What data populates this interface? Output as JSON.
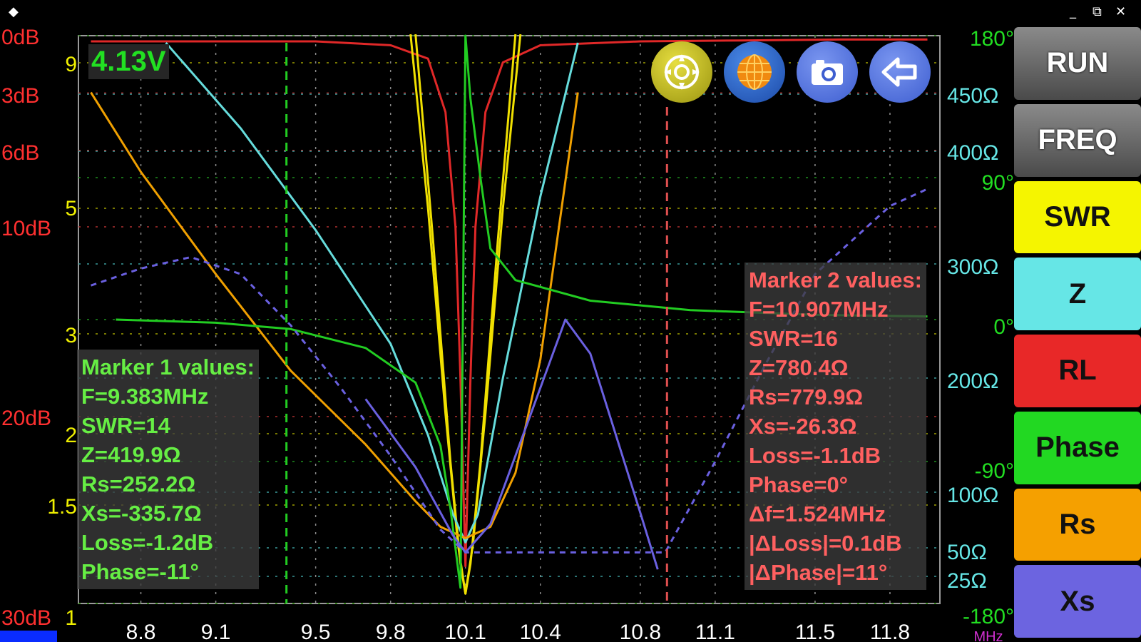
{
  "window": {
    "menu_icon": "◆",
    "controls": [
      "_",
      "⧉",
      "✕"
    ]
  },
  "voltage": "4.13V",
  "toolbar": [
    {
      "name": "target-icon",
      "color": "#c8c020"
    },
    {
      "name": "globe-icon",
      "color": "#2f6fd0"
    },
    {
      "name": "camera-icon",
      "color": "#4a6fe0"
    },
    {
      "name": "back-arrow-icon",
      "color": "#4a6fe0"
    }
  ],
  "sidebar": {
    "items": [
      {
        "label": "RUN",
        "bg": "gray",
        "fg": "#ffffff"
      },
      {
        "label": "FREQ",
        "bg": "gray",
        "fg": "#ffffff"
      },
      {
        "label": "SWR",
        "bg": "#f5f500",
        "fg": "#111111"
      },
      {
        "label": "Z",
        "bg": "#66e6e6",
        "fg": "#111111"
      },
      {
        "label": "RL",
        "bg": "#e82828",
        "fg": "#111111"
      },
      {
        "label": "Phase",
        "bg": "#22d822",
        "fg": "#111111"
      },
      {
        "label": "Rs",
        "bg": "#f5a000",
        "fg": "#111111"
      },
      {
        "label": "Xs",
        "bg": "#6c64e0",
        "fg": "#111111"
      }
    ]
  },
  "marker1": {
    "color": "#66ee44",
    "lines": [
      "Marker 1 values:",
      "F=9.383MHz",
      "SWR=14",
      "Z=419.9Ω",
      "Rs=252.2Ω",
      "Xs=-335.7Ω",
      "Loss=-1.2dB",
      "Phase=-11°"
    ]
  },
  "marker2": {
    "color": "#ff6060",
    "lines": [
      "Marker 2 values:",
      "F=10.907MHz",
      "SWR=16",
      "Z=780.4Ω",
      "Rs=779.9Ω",
      "Xs=-26.3Ω",
      "Loss=-1.1dB",
      "Phase=0°",
      "Δf=1.524MHz",
      "|ΔLoss|=0.1dB",
      "|ΔPhase|=11°"
    ]
  },
  "chart_data": {
    "type": "line",
    "x_unit_label": "MHz",
    "xlim": [
      8.55,
      12.0
    ],
    "x_ticks": [
      "8.8",
      "9.1",
      "9.5",
      "9.8",
      "10.1",
      "10.4",
      "10.8",
      "11.1",
      "11.5",
      "11.8"
    ],
    "x_tick_values": [
      8.8,
      9.1,
      9.5,
      9.8,
      10.1,
      10.4,
      10.8,
      11.1,
      11.5,
      11.8
    ],
    "markers": [
      9.383,
      10.907
    ],
    "axes": {
      "rl": {
        "color": "#ff3030",
        "ticks": [
          {
            "label": "0dB",
            "v": 0
          },
          {
            "label": "3dB",
            "v": 3
          },
          {
            "label": "6dB",
            "v": 6
          },
          {
            "label": "10dB",
            "v": 10
          },
          {
            "label": "20dB",
            "v": 20
          },
          {
            "label": "30dB",
            "v": 30
          }
        ]
      },
      "swr": {
        "color": "#f0f000",
        "ticks": [
          {
            "label": "9",
            "v": 9
          },
          {
            "label": "5",
            "v": 5
          },
          {
            "label": "3",
            "v": 3
          },
          {
            "label": "2",
            "v": 2
          },
          {
            "label": "1.5",
            "v": 1.5
          },
          {
            "label": "1",
            "v": 1
          }
        ]
      },
      "phase": {
        "color": "#22dd22",
        "ticks": [
          {
            "label": "180°",
            "v": 180
          },
          {
            "label": "90°",
            "v": 90
          },
          {
            "label": "0°",
            "v": 0
          },
          {
            "label": "-90°",
            "v": -90
          },
          {
            "label": "-180°",
            "v": -180
          }
        ]
      },
      "z": {
        "color": "#66e6e6",
        "ticks": [
          {
            "label": "450Ω",
            "v": 450
          },
          {
            "label": "400Ω",
            "v": 400
          },
          {
            "label": "300Ω",
            "v": 300
          },
          {
            "label": "200Ω",
            "v": 200
          },
          {
            "label": "100Ω",
            "v": 100
          },
          {
            "label": "50Ω",
            "v": 50
          },
          {
            "label": "25Ω",
            "v": 25
          }
        ]
      }
    },
    "series": [
      {
        "key": "rl",
        "color": "#e02828",
        "x": [
          8.6,
          9.0,
          9.5,
          9.8,
          9.95,
          10.02,
          10.06,
          10.08,
          10.1,
          10.12,
          10.14,
          10.18,
          10.25,
          10.4,
          10.8,
          11.2,
          11.6,
          11.95
        ],
        "y": [
          0.3,
          0.3,
          0.3,
          0.5,
          1.2,
          4,
          10,
          18,
          28,
          18,
          10,
          4,
          1.4,
          0.5,
          0.3,
          0.25,
          0.2,
          0.2
        ]
      },
      {
        "key": "swr",
        "color": "#f0e000",
        "x": [
          9.88,
          9.95,
          10.02,
          10.07,
          10.1,
          10.13,
          10.18,
          10.25,
          10.32
        ],
        "y": [
          10,
          5,
          2.2,
          1.3,
          1.05,
          1.3,
          2.2,
          5,
          10
        ]
      },
      {
        "key": "swr",
        "color": "#f0e000",
        "x": [
          9.9,
          9.97,
          10.04,
          10.08,
          10.1,
          10.12,
          10.16,
          10.23,
          10.3
        ],
        "y": [
          10,
          4.5,
          1.8,
          1.2,
          1.05,
          1.2,
          1.8,
          4.5,
          10
        ]
      },
      {
        "key": "z",
        "color": "#66dcdc",
        "x": [
          8.9,
          9.2,
          9.5,
          9.8,
          9.95,
          10.05,
          10.1,
          10.15,
          10.25,
          10.4,
          10.55
        ],
        "y": [
          520,
          420,
          330,
          230,
          150,
          80,
          55,
          80,
          200,
          360,
          520
        ]
      },
      {
        "key": "rs",
        "color": "#f0a000",
        "x": [
          8.6,
          8.8,
          9.1,
          9.4,
          9.7,
          9.9,
          10.0,
          10.1,
          10.2,
          10.3,
          10.4,
          10.55
        ],
        "y": [
          9,
          7.6,
          5.8,
          4.1,
          2.8,
          1.8,
          1.35,
          1.15,
          1.35,
          2.3,
          4.3,
          9
        ]
      },
      {
        "key": "phase",
        "color": "#22cc22",
        "x": [
          8.7,
          9.1,
          9.4,
          9.7,
          9.9,
          10.0,
          10.04,
          10.08,
          10.1,
          10.12,
          10.16,
          10.2,
          10.3,
          10.6,
          11.0,
          11.5,
          11.95
        ],
        "y": [
          0,
          -2,
          -6,
          -18,
          -40,
          -80,
          -120,
          -170,
          180,
          140,
          90,
          45,
          25,
          12,
          6,
          3,
          2
        ]
      },
      {
        "key": "xs",
        "color": "#6a60e0",
        "dashed": false,
        "x": [
          9.7,
          9.9,
          10.05,
          10.1,
          10.2,
          10.35,
          10.5,
          10.6,
          10.7,
          10.8,
          10.87
        ],
        "y": [
          3.6,
          2.4,
          1.2,
          0.9,
          1.4,
          3.2,
          5.0,
          4.4,
          3.0,
          1.6,
          0.6
        ]
      },
      {
        "key": "xs",
        "color": "#6a60e0",
        "dashed": true,
        "x": [
          8.6,
          8.8,
          9.0,
          9.2,
          9.4,
          9.6,
          9.8,
          10.0,
          10.1,
          10.9,
          11.1,
          11.3,
          11.5,
          11.8,
          11.95
        ],
        "y": [
          5.6,
          5.9,
          6.1,
          5.8,
          4.9,
          3.8,
          2.6,
          1.3,
          0.9,
          0.9,
          2.5,
          4.2,
          5.8,
          7.0,
          7.3
        ]
      }
    ]
  }
}
